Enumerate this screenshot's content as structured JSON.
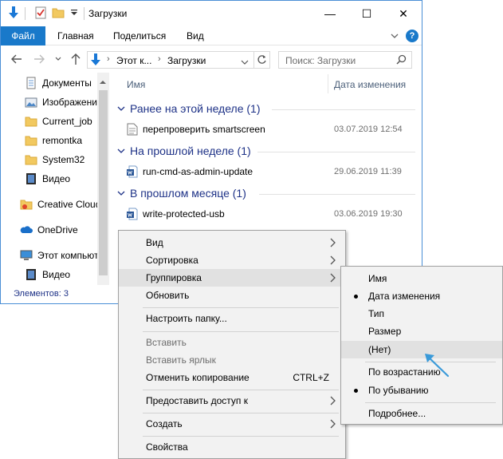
{
  "window": {
    "title": "Загрузки",
    "controls": {
      "minimize": "—",
      "maximize": "☐",
      "close": "✕"
    }
  },
  "ribbon": {
    "tabs": [
      "Файл",
      "Главная",
      "Поделиться",
      "Вид"
    ]
  },
  "address": {
    "path": [
      "Этот к...",
      "Загрузки"
    ],
    "search_placeholder": "Поиск: Загрузки"
  },
  "sidebar": {
    "items": [
      {
        "label": "Документы",
        "icon": "documents-icon",
        "pinned": true
      },
      {
        "label": "Изображения",
        "icon": "pictures-icon",
        "pinned": true
      },
      {
        "label": "Current_job",
        "icon": "folder-icon"
      },
      {
        "label": "remontka",
        "icon": "folder-icon"
      },
      {
        "label": "System32",
        "icon": "folder-icon"
      },
      {
        "label": "Видео",
        "icon": "video-folder-icon"
      },
      {
        "label": "Creative Cloud",
        "icon": "creative-cloud-icon"
      },
      {
        "label": "OneDrive",
        "icon": "onedrive-icon"
      },
      {
        "label": "Этот компьютер",
        "icon": "computer-icon"
      },
      {
        "label": "Видео",
        "icon": "video-folder-icon"
      }
    ]
  },
  "columns": {
    "name": "Имя",
    "date": "Дата изменения"
  },
  "groups": [
    {
      "label": "Ранее на этой неделе (1)",
      "files": [
        {
          "name": "перепроверить smartscreen",
          "date": "03.07.2019 12:54",
          "type": "text"
        }
      ]
    },
    {
      "label": "На прошлой неделе (1)",
      "files": [
        {
          "name": "run-cmd-as-admin-update",
          "date": "29.06.2019 11:39",
          "type": "word"
        }
      ]
    },
    {
      "label": "В прошлом месяце (1)",
      "files": [
        {
          "name": "write-protected-usb",
          "date": "03.06.2019 19:30",
          "type": "word"
        }
      ]
    }
  ],
  "status": {
    "text": "Элементов: 3"
  },
  "context_menu": {
    "view": "Вид",
    "sort": "Сортировка",
    "group": "Группировка",
    "refresh": "Обновить",
    "customize": "Настроить папку...",
    "paste": "Вставить",
    "paste_shortcut": "Вставить ярлык",
    "undo_copy": "Отменить копирование",
    "undo_shortcut": "CTRL+Z",
    "share": "Предоставить доступ к",
    "create": "Создать",
    "properties": "Свойства"
  },
  "submenu": {
    "name": "Имя",
    "date": "Дата изменения",
    "type": "Тип",
    "size": "Размер",
    "none": "(Нет)",
    "ascending": "По возрастанию",
    "descending": "По убыванию",
    "more": "Подробнее..."
  },
  "colors": {
    "accent": "#1979ca",
    "group_text": "#1e3287",
    "pointer_arrow": "#3a9ad9"
  }
}
